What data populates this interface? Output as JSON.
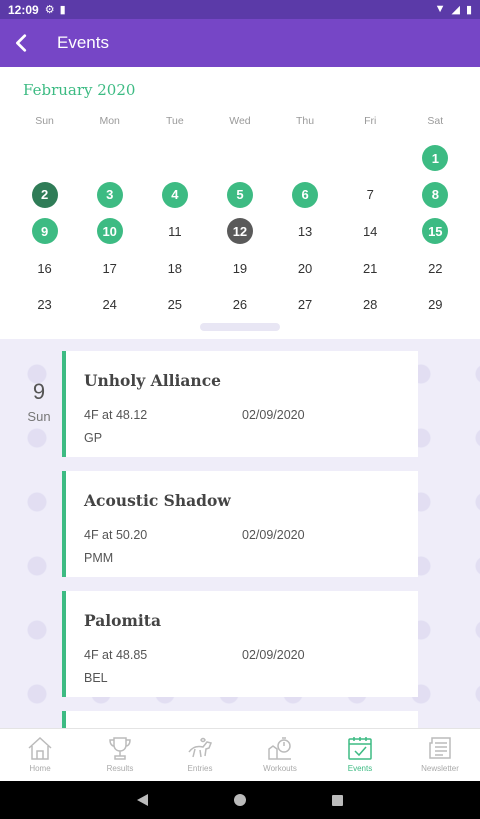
{
  "status_bar": {
    "time": "12:09"
  },
  "app_bar": {
    "title": "Events"
  },
  "calendar": {
    "month": "February 2020",
    "weekdays": [
      "Sun",
      "Mon",
      "Tue",
      "Wed",
      "Thu",
      "Fri",
      "Sat"
    ],
    "days": [
      {
        "label": "",
        "state": "blank"
      },
      {
        "label": "",
        "state": "blank"
      },
      {
        "label": "",
        "state": "blank"
      },
      {
        "label": "",
        "state": "blank"
      },
      {
        "label": "",
        "state": "blank"
      },
      {
        "label": "",
        "state": "blank"
      },
      {
        "label": "1",
        "state": "event"
      },
      {
        "label": "2",
        "state": "selected"
      },
      {
        "label": "3",
        "state": "event"
      },
      {
        "label": "4",
        "state": "event"
      },
      {
        "label": "5",
        "state": "event"
      },
      {
        "label": "6",
        "state": "event"
      },
      {
        "label": "7",
        "state": "normal"
      },
      {
        "label": "8",
        "state": "event"
      },
      {
        "label": "9",
        "state": "event"
      },
      {
        "label": "10",
        "state": "event"
      },
      {
        "label": "11",
        "state": "normal"
      },
      {
        "label": "12",
        "state": "today"
      },
      {
        "label": "13",
        "state": "normal"
      },
      {
        "label": "14",
        "state": "normal"
      },
      {
        "label": "15",
        "state": "event"
      },
      {
        "label": "16",
        "state": "normal"
      },
      {
        "label": "17",
        "state": "normal"
      },
      {
        "label": "18",
        "state": "normal"
      },
      {
        "label": "19",
        "state": "normal"
      },
      {
        "label": "20",
        "state": "normal"
      },
      {
        "label": "21",
        "state": "normal"
      },
      {
        "label": "22",
        "state": "normal"
      },
      {
        "label": "23",
        "state": "normal"
      },
      {
        "label": "24",
        "state": "normal"
      },
      {
        "label": "25",
        "state": "normal"
      },
      {
        "label": "26",
        "state": "normal"
      },
      {
        "label": "27",
        "state": "normal"
      },
      {
        "label": "28",
        "state": "normal"
      },
      {
        "label": "29",
        "state": "normal"
      }
    ]
  },
  "event_list": {
    "date_number": "9",
    "date_weekday": "Sun",
    "events": [
      {
        "name": "Unholy Alliance",
        "distance": "4F at 48.12",
        "date": "02/09/2020",
        "track": "GP"
      },
      {
        "name": "Acoustic Shadow",
        "distance": "4F at 50.20",
        "date": "02/09/2020",
        "track": "PMM"
      },
      {
        "name": "Palomita",
        "distance": "4F at 48.85",
        "date": "02/09/2020",
        "track": "BEL"
      }
    ]
  },
  "bottom_nav": {
    "items": [
      {
        "label": "Home",
        "icon": "home-icon"
      },
      {
        "label": "Results",
        "icon": "trophy-icon"
      },
      {
        "label": "Entries",
        "icon": "horse-racing-icon"
      },
      {
        "label": "Workouts",
        "icon": "stopwatch-horse-icon"
      },
      {
        "label": "Events",
        "icon": "calendar-check-icon",
        "active": true
      },
      {
        "label": "Newsletter",
        "icon": "newspaper-icon"
      }
    ]
  },
  "colors": {
    "status_bar": "#5b3aa8",
    "app_bar": "#7646c6",
    "accent_green": "#3dbb83",
    "selected_dark_green": "#2f7c57",
    "today_gray": "#5a5a5a",
    "events_background": "#efedf9"
  }
}
